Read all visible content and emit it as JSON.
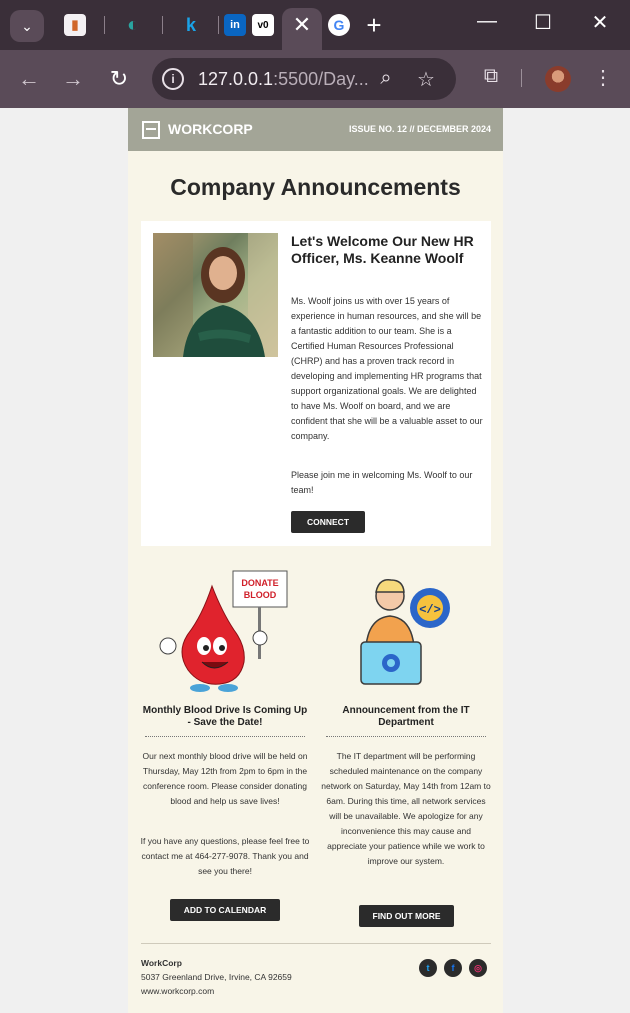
{
  "browser": {
    "url_host": "127.0.0.1",
    "url_rest": ":5500/Day...",
    "new_tab_label": "+",
    "tabs": [
      {
        "icon": "office-tab-icon",
        "glyph": "▮"
      },
      {
        "icon": "edge-tab-icon",
        "glyph": "◐"
      },
      {
        "icon": "k-tab-icon",
        "glyph": "k"
      },
      {
        "icon": "linkedin-tab-icon",
        "glyph": "in"
      },
      {
        "icon": "v0-tab-icon",
        "glyph": "v0"
      },
      {
        "icon": "google-tab-icon",
        "glyph": "G"
      }
    ]
  },
  "newsletter": {
    "brand": "WORKCORP",
    "issue": "ISSUE NO. 12 // DECEMBER 2024",
    "title": "Company Announcements",
    "feature": {
      "heading": "Let's Welcome Our New HR Officer, Ms. Keanne Woolf",
      "body": "Ms. Woolf joins us with over 15 years of experience in human resources, and she will be a fantastic addition to our team. She is a Certified Human Resources Professional (CHRP) and has a proven track record in developing and implementing HR programs that support organizational goals. We are delighted to have Ms. Woolf on board, and we are confident that she will be a valuable asset to our company.",
      "body2": "Please join me in welcoming Ms. Woolf to our team!",
      "button": "CONNECT"
    },
    "left_column": {
      "sign_text_1": "DONATE",
      "sign_text_2": "BLOOD",
      "heading": "Monthly Blood Drive Is Coming Up - Save the Date!",
      "body": "Our next monthly blood drive will be held on Thursday, May 12th from 2pm to 6pm in the conference room. Please consider donating blood and help us save lives!",
      "body2": "If you have any questions, please feel free to contact me at 464-277-9078. Thank you and see you there!",
      "button": "ADD TO CALENDAR"
    },
    "right_column": {
      "heading": "Announcement from the IT Department",
      "body": "The IT department will be performing scheduled maintenance on the company network on Saturday, May 14th from 12am to 6am. During this time, all network services will be unavailable. We apologize for any inconvenience this may cause and appreciate your patience while we work to improve our system.",
      "button": "FIND OUT MORE"
    },
    "footer": {
      "company": "WorkCorp",
      "address": "5037 Greenland Drive, Irvine, CA 92659",
      "website": "www.workcorp.com",
      "social": [
        {
          "name": "twitter-icon",
          "glyph": "t",
          "color": "#1da1f2"
        },
        {
          "name": "facebook-icon",
          "glyph": "f",
          "color": "#1877f2"
        },
        {
          "name": "instagram-icon",
          "glyph": "◎",
          "color": "#e1306c"
        }
      ]
    }
  },
  "colors": {
    "header_bg": "#a3a597",
    "page_bg": "#f8f5e8",
    "button_bg": "#2b2b2b",
    "browser_frame": "#3a2f39"
  }
}
